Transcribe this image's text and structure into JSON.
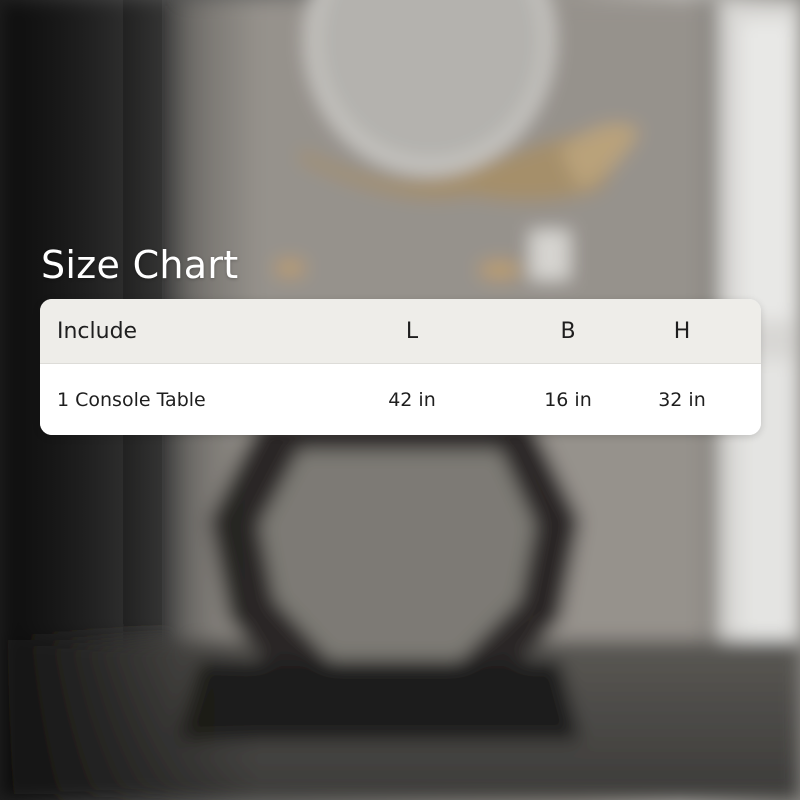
{
  "title": "Size Chart",
  "table": {
    "headers": [
      "Include",
      "L",
      "B",
      "H"
    ],
    "rows": [
      [
        "1 Console Table",
        "42 in",
        "16 in",
        "32 in"
      ]
    ]
  },
  "colors": {
    "header_bg": "#eeede9",
    "row_bg": "#ffffff",
    "text": "#1e1e1e",
    "title": "#ffffff"
  }
}
